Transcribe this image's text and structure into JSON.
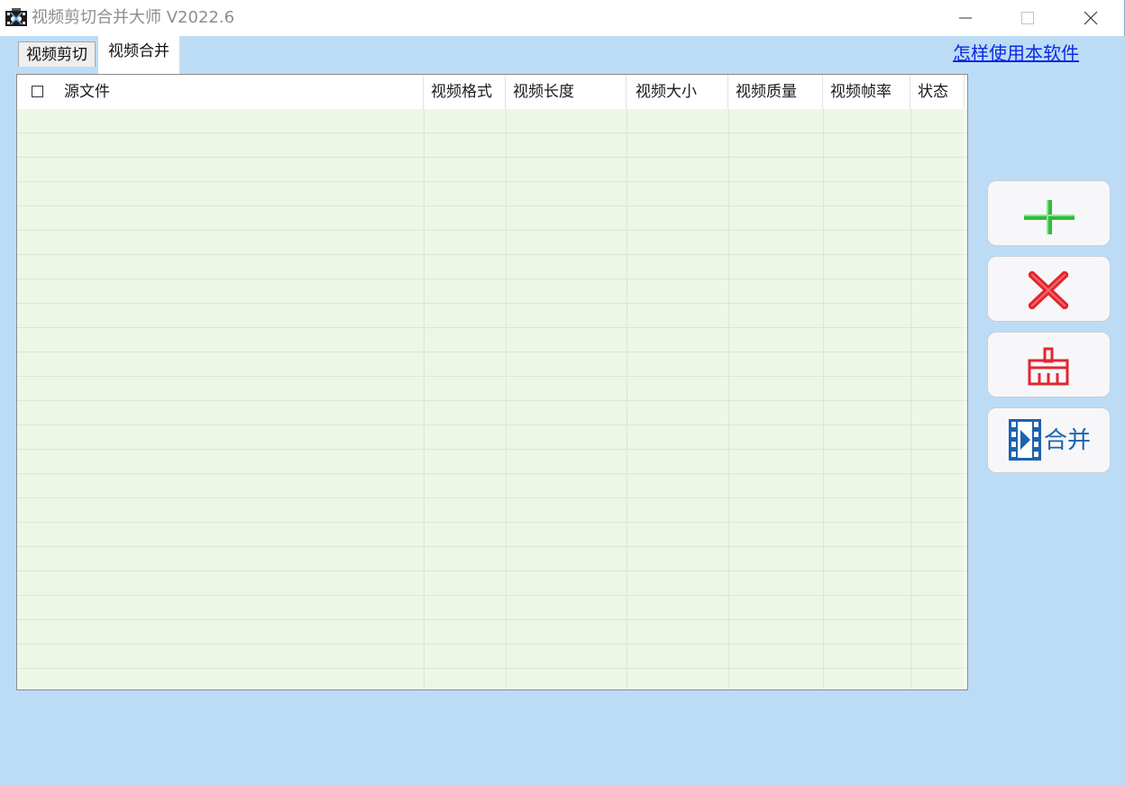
{
  "window": {
    "title": "视频剪切合并大师 V2022.6"
  },
  "tabs": [
    {
      "label": "视频剪切",
      "selected": false
    },
    {
      "label": "视频合并",
      "selected": true
    }
  ],
  "help_link": "怎样使用本软件",
  "table": {
    "columns": [
      "源文件",
      "视频格式",
      "视频长度",
      "视频大小",
      "视频质量",
      "视频帧率",
      "状态"
    ],
    "select_all_checked": false,
    "rows": []
  },
  "actions": {
    "add_icon": "green-plus-icon",
    "remove_icon": "red-x-icon",
    "clear_icon": "broom-icon",
    "merge_icon": "film-play-icon",
    "merge_label": "合并"
  },
  "colors": {
    "background": "#bcdcf6",
    "table_body": "#eef7e6",
    "link": "#0b28e6",
    "merge_text": "#1c63ad",
    "add_icon": "#2fbd3a",
    "remove_icon": "#e3262d",
    "clear_icon": "#e3262d"
  }
}
